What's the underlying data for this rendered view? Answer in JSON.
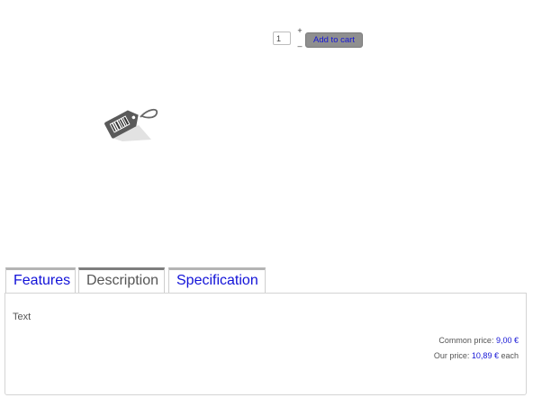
{
  "purchase": {
    "quantity": "1",
    "plus_label": "+",
    "minus_label": "–",
    "add_to_cart_label": "Add to cart"
  },
  "product_image": {
    "icon": "price-tag-icon"
  },
  "tabs": [
    {
      "label": "Features",
      "active": false
    },
    {
      "label": "Description",
      "active": true
    },
    {
      "label": "Specification",
      "active": false
    }
  ],
  "description": {
    "text": "Text",
    "common_price_label": "Common price:",
    "common_price_value": "9,00 €",
    "our_price_label": "Our price:",
    "our_price_value": "10,89 €",
    "our_price_unit": "each"
  },
  "colors": {
    "link": "#1515d6",
    "button_bg": "#8f8f8f",
    "text": "#555555"
  }
}
